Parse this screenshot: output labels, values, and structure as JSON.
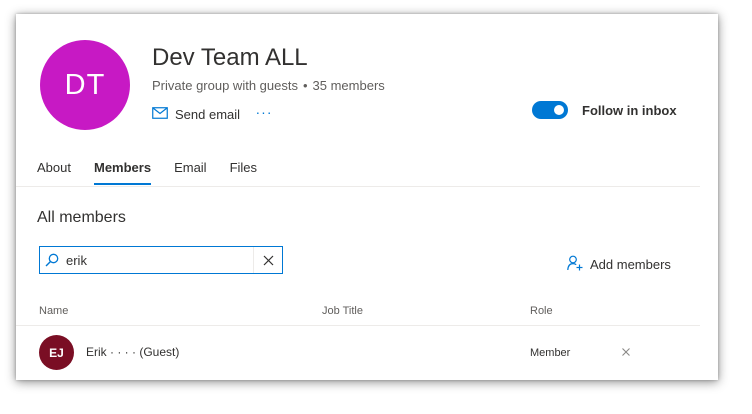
{
  "group": {
    "initials": "DT",
    "name": "Dev Team ALL",
    "privacy": "Private group with guests",
    "separator": "•",
    "members_count": "35 members",
    "send_email_label": "Send email",
    "more_label": "···",
    "follow_label": "Follow in inbox",
    "follow_on": true
  },
  "tabs": [
    {
      "label": "About",
      "active": false
    },
    {
      "label": "Members",
      "active": true
    },
    {
      "label": "Email",
      "active": false
    },
    {
      "label": "Files",
      "active": false
    }
  ],
  "members_section": {
    "title": "All members",
    "search": {
      "value": "erik",
      "placeholder": ""
    },
    "add_members_label": "Add members",
    "columns": {
      "name": "Name",
      "job_title": "Job Title",
      "role": "Role"
    },
    "rows": [
      {
        "initials": "EJ",
        "name": "Erik ·  ·  ·  ·  (Guest)",
        "job_title": "",
        "role": "Member"
      }
    ]
  },
  "colors": {
    "group_avatar": "#c719c4",
    "member_avatar": "#7a0e24",
    "accent": "#0078d4"
  },
  "icons": {
    "send_email": "mail-icon",
    "search": "search-icon",
    "clear": "close-icon",
    "add_members": "add-person-icon",
    "remove_member": "close-icon"
  }
}
